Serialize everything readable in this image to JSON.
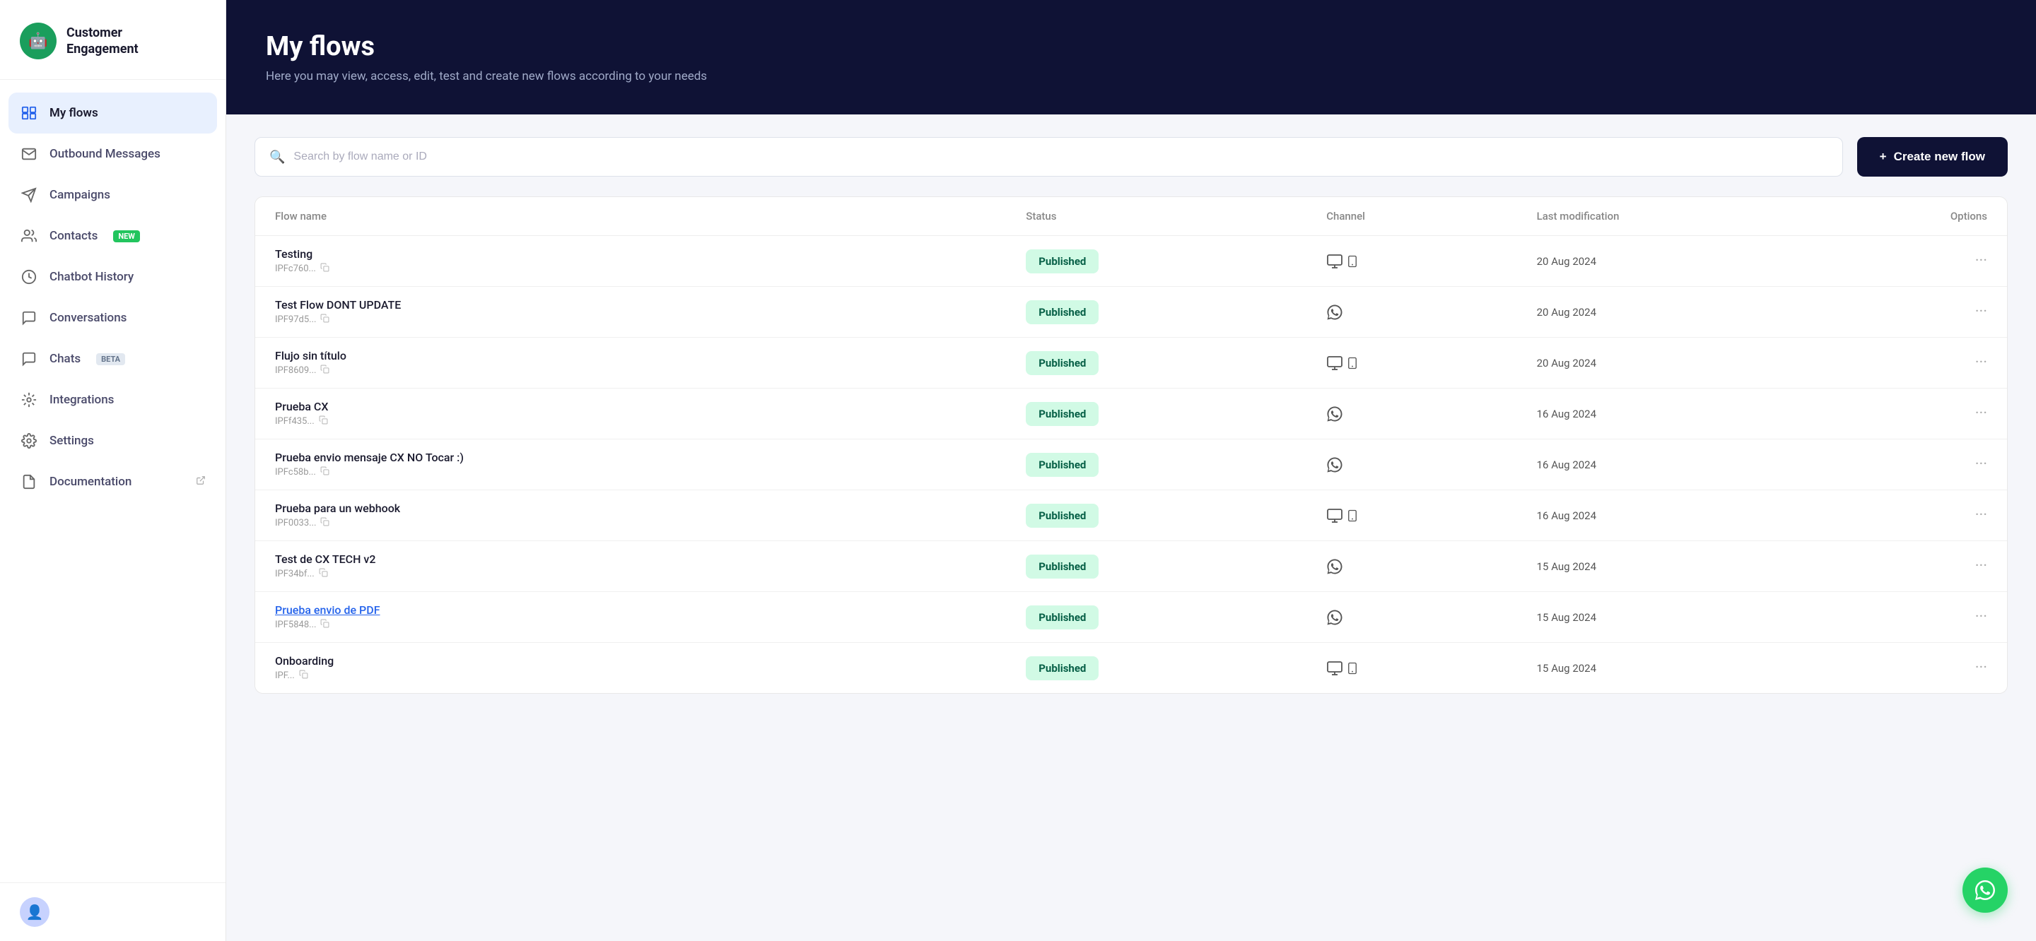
{
  "sidebar": {
    "logo": {
      "icon": "🤖",
      "title": "Customer\nEngagement"
    },
    "nav_items": [
      {
        "id": "my-flows",
        "label": "My flows",
        "icon": "⊞",
        "active": true,
        "badge": null
      },
      {
        "id": "outbound-messages",
        "label": "Outbound Messages",
        "icon": "✉",
        "active": false,
        "badge": null
      },
      {
        "id": "campaigns",
        "label": "Campaigns",
        "icon": "📢",
        "active": false,
        "badge": null
      },
      {
        "id": "contacts",
        "label": "Contacts",
        "icon": "👤",
        "active": false,
        "badge": "NEW"
      },
      {
        "id": "chatbot-history",
        "label": "Chatbot History",
        "icon": "🕐",
        "active": false,
        "badge": null
      },
      {
        "id": "conversations",
        "label": "Conversations",
        "icon": "💬",
        "active": false,
        "badge": null
      },
      {
        "id": "chats",
        "label": "Chats",
        "icon": "💬",
        "active": false,
        "badge": "BETA"
      },
      {
        "id": "integrations",
        "label": "Integrations",
        "icon": "⚙",
        "active": false,
        "badge": null
      },
      {
        "id": "settings",
        "label": "Settings",
        "icon": "⚙",
        "active": false,
        "badge": null
      },
      {
        "id": "documentation",
        "label": "Documentation",
        "icon": "📄",
        "active": false,
        "badge": null
      }
    ]
  },
  "header": {
    "title": "My flows",
    "subtitle": "Here you may view, access, edit, test and create new flows according to your needs"
  },
  "toolbar": {
    "search_placeholder": "Search by flow name or ID",
    "create_button": "Create new flow"
  },
  "table": {
    "columns": [
      "Flow name",
      "Status",
      "Channel",
      "Last modification",
      "Options"
    ],
    "rows": [
      {
        "name": "Testing",
        "id": "IPFc760...",
        "status": "Published",
        "channel": "desktop_mobile",
        "date": "20 Aug 2024",
        "is_link": false
      },
      {
        "name": "Test Flow DONT UPDATE",
        "id": "IPF97d5...",
        "status": "Published",
        "channel": "whatsapp",
        "date": "20 Aug 2024",
        "is_link": false
      },
      {
        "name": "Flujo sin título",
        "id": "IPF8609...",
        "status": "Published",
        "channel": "desktop_mobile",
        "date": "20 Aug 2024",
        "is_link": false
      },
      {
        "name": "Prueba CX",
        "id": "IPFf435...",
        "status": "Published",
        "channel": "whatsapp",
        "date": "16 Aug 2024",
        "is_link": false
      },
      {
        "name": "Prueba envio mensaje CX NO Tocar :)",
        "id": "IPFc58b...",
        "status": "Published",
        "channel": "whatsapp",
        "date": "16 Aug 2024",
        "is_link": false
      },
      {
        "name": "Prueba para un webhook",
        "id": "IPF0033...",
        "status": "Published",
        "channel": "desktop_mobile",
        "date": "16 Aug 2024",
        "is_link": false
      },
      {
        "name": "Test de CX TECH v2",
        "id": "IPF34bf...",
        "status": "Published",
        "channel": "whatsapp",
        "date": "15 Aug 2024",
        "is_link": false
      },
      {
        "name": "Prueba envio de PDF",
        "id": "IPF5848...",
        "status": "Published",
        "channel": "whatsapp",
        "date": "15 Aug 2024",
        "is_link": true
      },
      {
        "name": "Onboarding",
        "id": "IPF...",
        "status": "Published",
        "channel": "desktop_mobile",
        "date": "15 Aug 2024",
        "is_link": false
      }
    ]
  }
}
